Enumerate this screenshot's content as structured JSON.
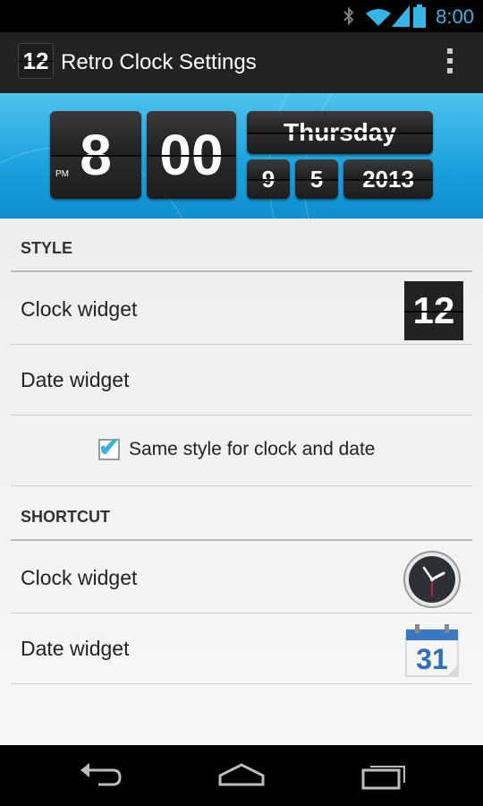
{
  "status_bar": {
    "time": "8:00",
    "icons": [
      "bluetooth-icon",
      "wifi-icon",
      "signal-icon",
      "battery-icon"
    ],
    "accent_color": "#33b5e5"
  },
  "action_bar": {
    "app_icon_text": "12",
    "title": "Retro Clock Settings",
    "overflow_icon": "overflow-menu-icon"
  },
  "preview": {
    "hour": "8",
    "minute": "00",
    "ampm": "PM",
    "day_name": "Thursday",
    "month": "9",
    "day": "5",
    "year": "2013"
  },
  "sections": {
    "style": {
      "header": "STYLE",
      "clock_widget_label": "Clock widget",
      "clock_widget_icon_text": "12",
      "date_widget_label": "Date widget",
      "same_style_label": "Same style for clock and date",
      "same_style_checked": true
    },
    "shortcut": {
      "header": "SHORTCUT",
      "clock_widget_label": "Clock widget",
      "date_widget_label": "Date widget",
      "calendar_icon_text": "31"
    }
  },
  "nav_bar": {
    "buttons": [
      "back-icon",
      "home-icon",
      "recent-apps-icon"
    ]
  }
}
